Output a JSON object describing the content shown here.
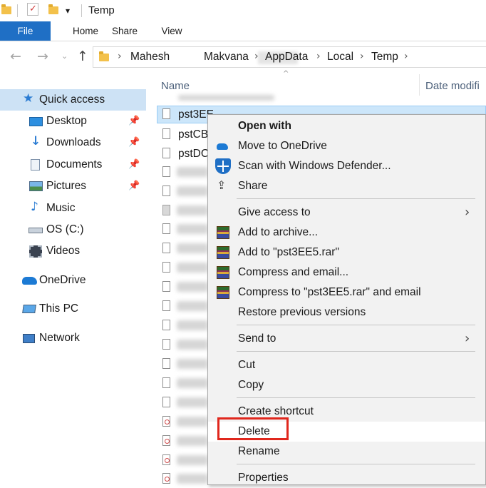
{
  "window": {
    "title": "Temp"
  },
  "ribbon": {
    "tabs": [
      "File",
      "Home",
      "Share",
      "View"
    ]
  },
  "address": {
    "crumbs": [
      "Mahesh",
      "Makvana",
      "AppData",
      "Local",
      "Temp"
    ],
    "separator": "›"
  },
  "nav": {
    "items": [
      {
        "label": "Quick access",
        "icon": "star-icon"
      },
      {
        "label": "Desktop",
        "icon": "desktop-icon",
        "pinned": true
      },
      {
        "label": "Downloads",
        "icon": "download-icon",
        "pinned": true
      },
      {
        "label": "Documents",
        "icon": "documents-icon",
        "pinned": true
      },
      {
        "label": "Pictures",
        "icon": "pictures-icon",
        "pinned": true
      },
      {
        "label": "Music",
        "icon": "music-icon"
      },
      {
        "label": "OS (C:)",
        "icon": "drive-icon"
      },
      {
        "label": "Videos",
        "icon": "videos-icon"
      },
      {
        "label": "OneDrive",
        "icon": "cloud-icon"
      },
      {
        "label": "This PC",
        "icon": "computer-icon"
      },
      {
        "label": "Network",
        "icon": "network-icon"
      }
    ]
  },
  "filelist": {
    "columns": {
      "name": "Name",
      "date": "Date modifi"
    },
    "files": [
      "pst3EE",
      "pstCB",
      "pstDC"
    ]
  },
  "context_menu": {
    "open_with": "Open with",
    "move_onedrive": "Move to OneDrive",
    "scan": "Scan with Windows Defender...",
    "share": "Share",
    "give_access": "Give access to",
    "add_archive": "Add to archive...",
    "add_rar": "Add to \"pst3EE5.rar\"",
    "compress_email": "Compress and email...",
    "compress_rar_email": "Compress to \"pst3EE5.rar\" and email",
    "restore": "Restore previous versions",
    "send_to": "Send to",
    "cut": "Cut",
    "copy": "Copy",
    "create_shortcut": "Create shortcut",
    "delete": "Delete",
    "rename": "Rename",
    "properties": "Properties"
  },
  "colors": {
    "accent": "#1f6fc5",
    "highlight": "#e0271d",
    "selection": "#cce6fa"
  }
}
